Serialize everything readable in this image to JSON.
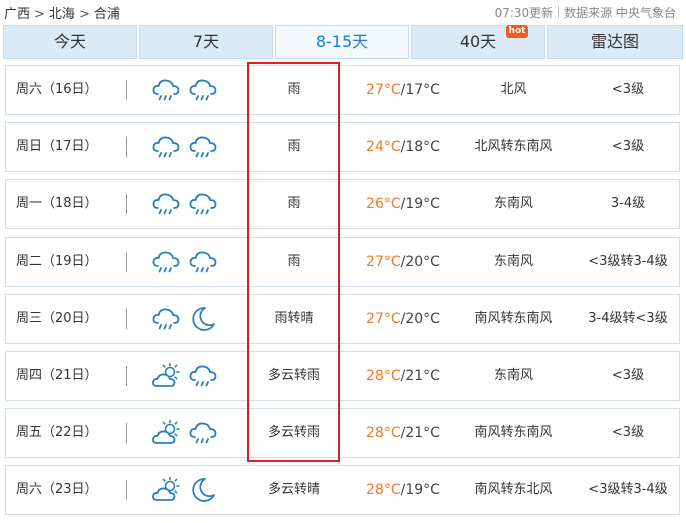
{
  "breadcrumb": [
    "广西",
    "北海",
    "合浦"
  ],
  "breadcrumb_sep": ">",
  "update_time": "07:30更新",
  "source": "数据来源 中央气象台",
  "tabs": [
    {
      "label": "今天"
    },
    {
      "label": "7天"
    },
    {
      "label": "8-15天",
      "active": true
    },
    {
      "label": "40天",
      "badge": "hot"
    },
    {
      "label": "雷达图"
    }
  ],
  "temp_sep": "/",
  "days": [
    {
      "day": "周六（16日）",
      "icons": [
        "rain-cloud-icon",
        "rain-cloud-icon"
      ],
      "desc": "雨",
      "high": "27°C",
      "low": "17°C",
      "wind": "北风",
      "level": "<3级"
    },
    {
      "day": "周日（17日）",
      "icons": [
        "rain-cloud-icon",
        "rain-cloud-icon"
      ],
      "desc": "雨",
      "high": "24°C",
      "low": "18°C",
      "wind": "北风转东南风",
      "level": "<3级"
    },
    {
      "day": "周一（18日）",
      "icons": [
        "rain-cloud-icon",
        "rain-cloud-icon"
      ],
      "desc": "雨",
      "high": "26°C",
      "low": "19°C",
      "wind": "东南风",
      "level": "3-4级"
    },
    {
      "day": "周二（19日）",
      "icons": [
        "rain-cloud-icon",
        "rain-cloud-icon"
      ],
      "desc": "雨",
      "high": "27°C",
      "low": "20°C",
      "wind": "东南风",
      "level": "<3级转3-4级"
    },
    {
      "day": "周三（20日）",
      "icons": [
        "rain-cloud-icon",
        "moon-icon"
      ],
      "desc": "雨转晴",
      "high": "27°C",
      "low": "20°C",
      "wind": "南风转东南风",
      "level": "3-4级转<3级"
    },
    {
      "day": "周四（21日）",
      "icons": [
        "sun-cloud-icon",
        "rain-cloud-icon"
      ],
      "desc": "多云转雨",
      "high": "28°C",
      "low": "21°C",
      "wind": "东南风",
      "level": "<3级"
    },
    {
      "day": "周五（22日）",
      "icons": [
        "sun-cloud-icon",
        "rain-cloud-icon"
      ],
      "desc": "多云转雨",
      "high": "28°C",
      "low": "21°C",
      "wind": "南风转东南风",
      "level": "<3级"
    },
    {
      "day": "周六（23日）",
      "icons": [
        "sun-cloud-icon",
        "moon-icon"
      ],
      "desc": "多云转晴",
      "high": "28°C",
      "low": "19°C",
      "wind": "南风转东北风",
      "level": "<3级转3-4级"
    }
  ],
  "colors": {
    "high_temp": "#f07a22",
    "active_tab": "#1a7fcf",
    "tab_bg": "#daeaf7",
    "highlight_box": "#e02020"
  }
}
